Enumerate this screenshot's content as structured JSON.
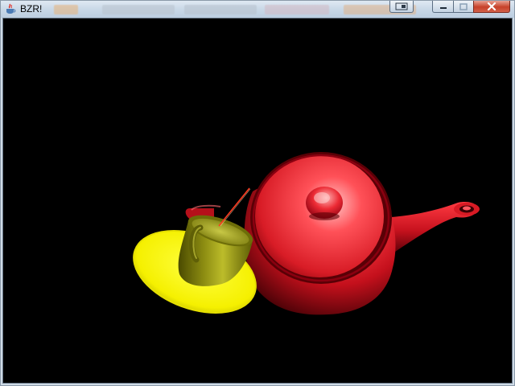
{
  "window": {
    "title": "BZR!",
    "controls": {
      "minimize": "minimize",
      "maximize": "maximize",
      "close": "close"
    }
  },
  "scene": {
    "background": "#000000",
    "teapot_color": "#e0202a",
    "cup_color": "#9a9a10",
    "saucer_color": "#ffff00",
    "stirrer_color": "#ff4020"
  },
  "icons": {
    "app": "java-coffee-cup-icon",
    "extra": "window-snap-icon",
    "minimize": "minimize-icon",
    "maximize": "maximize-icon",
    "close": "close-x-icon"
  }
}
